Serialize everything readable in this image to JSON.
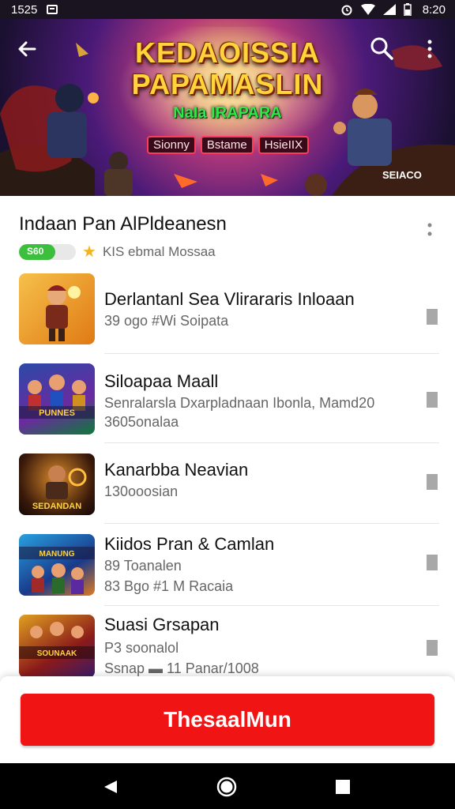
{
  "status_bar": {
    "time": "1525",
    "clock": "8:20",
    "icons": [
      "notification-icon",
      "alarm-icon",
      "wifi-icon",
      "signal-icon",
      "battery-icon"
    ]
  },
  "hero": {
    "title_line1": "KEDAOISSIA",
    "title_line2": "PAPAMASLIN",
    "subtitle": "NaIa IRAPARA",
    "tags": [
      "Sionny",
      "Bstame",
      "HsieIIX"
    ],
    "corner_text": "SEIACO"
  },
  "section": {
    "title": "Indaan Pan AlPldeanesn",
    "pill_label": "S60",
    "meta_text": "KIS ebmal Mossaa"
  },
  "items": [
    {
      "name": "Derlantanl Sea Vlirararis Inloaan",
      "lines": [
        "39 ogo #Wi Soipata"
      ],
      "thumb_caption": ""
    },
    {
      "name": "Siloapaa Maall",
      "lines": [
        "Senralarsla Dxarpladnaan Ibonla, Mamd20",
        "3605onalaa"
      ],
      "thumb_caption": "PUNNES"
    },
    {
      "name": "Kanarbba Neavian",
      "lines": [
        "130ooosian"
      ],
      "thumb_caption": "SEDANDAN"
    },
    {
      "name": "Kiidos Pran & Camlan",
      "lines": [
        "89 Toanalen",
        "83 Bgo #1 M Racaia"
      ],
      "thumb_caption": "MANUNG"
    },
    {
      "name": "Suasi Grsapan",
      "lines": [
        "P3 soonalol",
        "Ssnap ▬ 11 Panar/1008"
      ],
      "thumb_caption": "SOUNAAK"
    }
  ],
  "cta": {
    "label": "ThesaalMun"
  },
  "colors": {
    "accent": "#f01414",
    "green": "#3cbf3c",
    "star": "#f2b51c"
  }
}
